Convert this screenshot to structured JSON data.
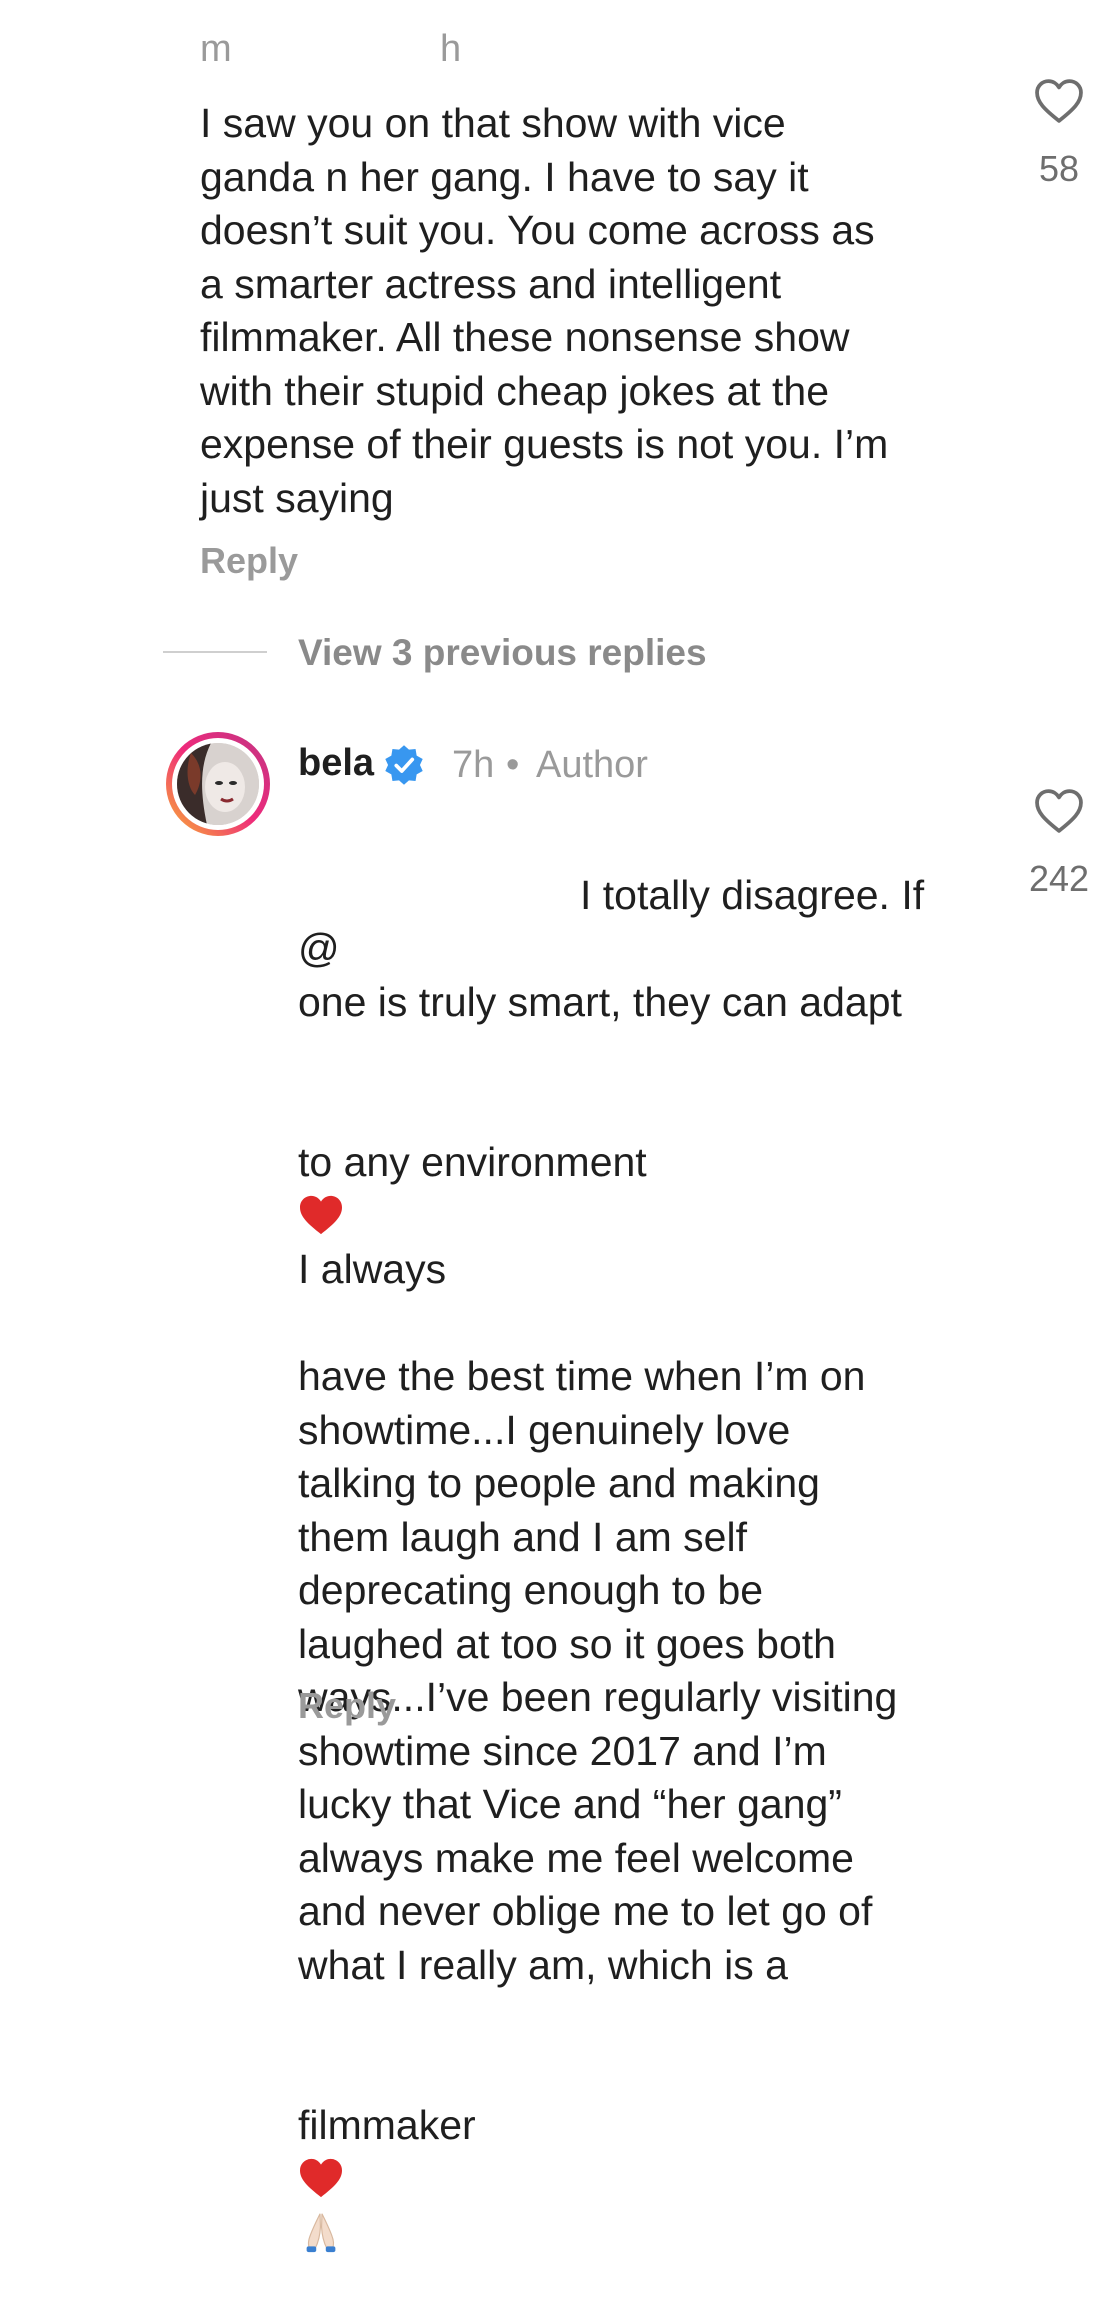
{
  "comment1": {
    "username": "m",
    "time": "h",
    "text": "I saw you on that show with vice\nganda n her gang. I have to say it\ndoesn’t suit you. You come across as\na smarter actress and intelligent\nfilmmaker. All these nonsense show\nwith their stupid cheap jokes at the\nexpense of their guests is not you. I’m\njust saying",
    "reply_label": "Reply",
    "like_count": "58",
    "like_icon": "heart-outline-icon"
  },
  "view_replies": {
    "label": "View 3 previous replies"
  },
  "comment2": {
    "username": "bela",
    "verified_icon": "verified-badge-icon",
    "time": "7h",
    "separator": "•",
    "author_tag": "Author",
    "mention": "@",
    "line1_rest": "I totally disagree. If",
    "line2": "one is truly smart, they can adapt",
    "line3_before_emoji": "to any environment",
    "line3_after_emoji": "I always",
    "text_rest": "have the best time when I’m on\nshowtime...I genuinely love\ntalking to people and making\nthem laugh and I am self\ndeprecating enough to be\nlaughed at too so it goes both\nways...I’ve been regularly visiting\nshowtime since 2017 and I’m\nlucky that Vice and “her gang”\nalways make me feel welcome\nand never oblige me to let go of\nwhat I really am, which is a",
    "last_line": "filmmaker",
    "emoji_heart": "red-heart-emoji",
    "emoji_hands": "folded-hands-emoji",
    "reply_label": "Reply",
    "like_count": "242",
    "like_icon": "heart-outline-icon",
    "avatar_ring_colors": [
      "#f9b233",
      "#ee2a7b",
      "#c13584"
    ],
    "verified_color": "#3897f0"
  }
}
